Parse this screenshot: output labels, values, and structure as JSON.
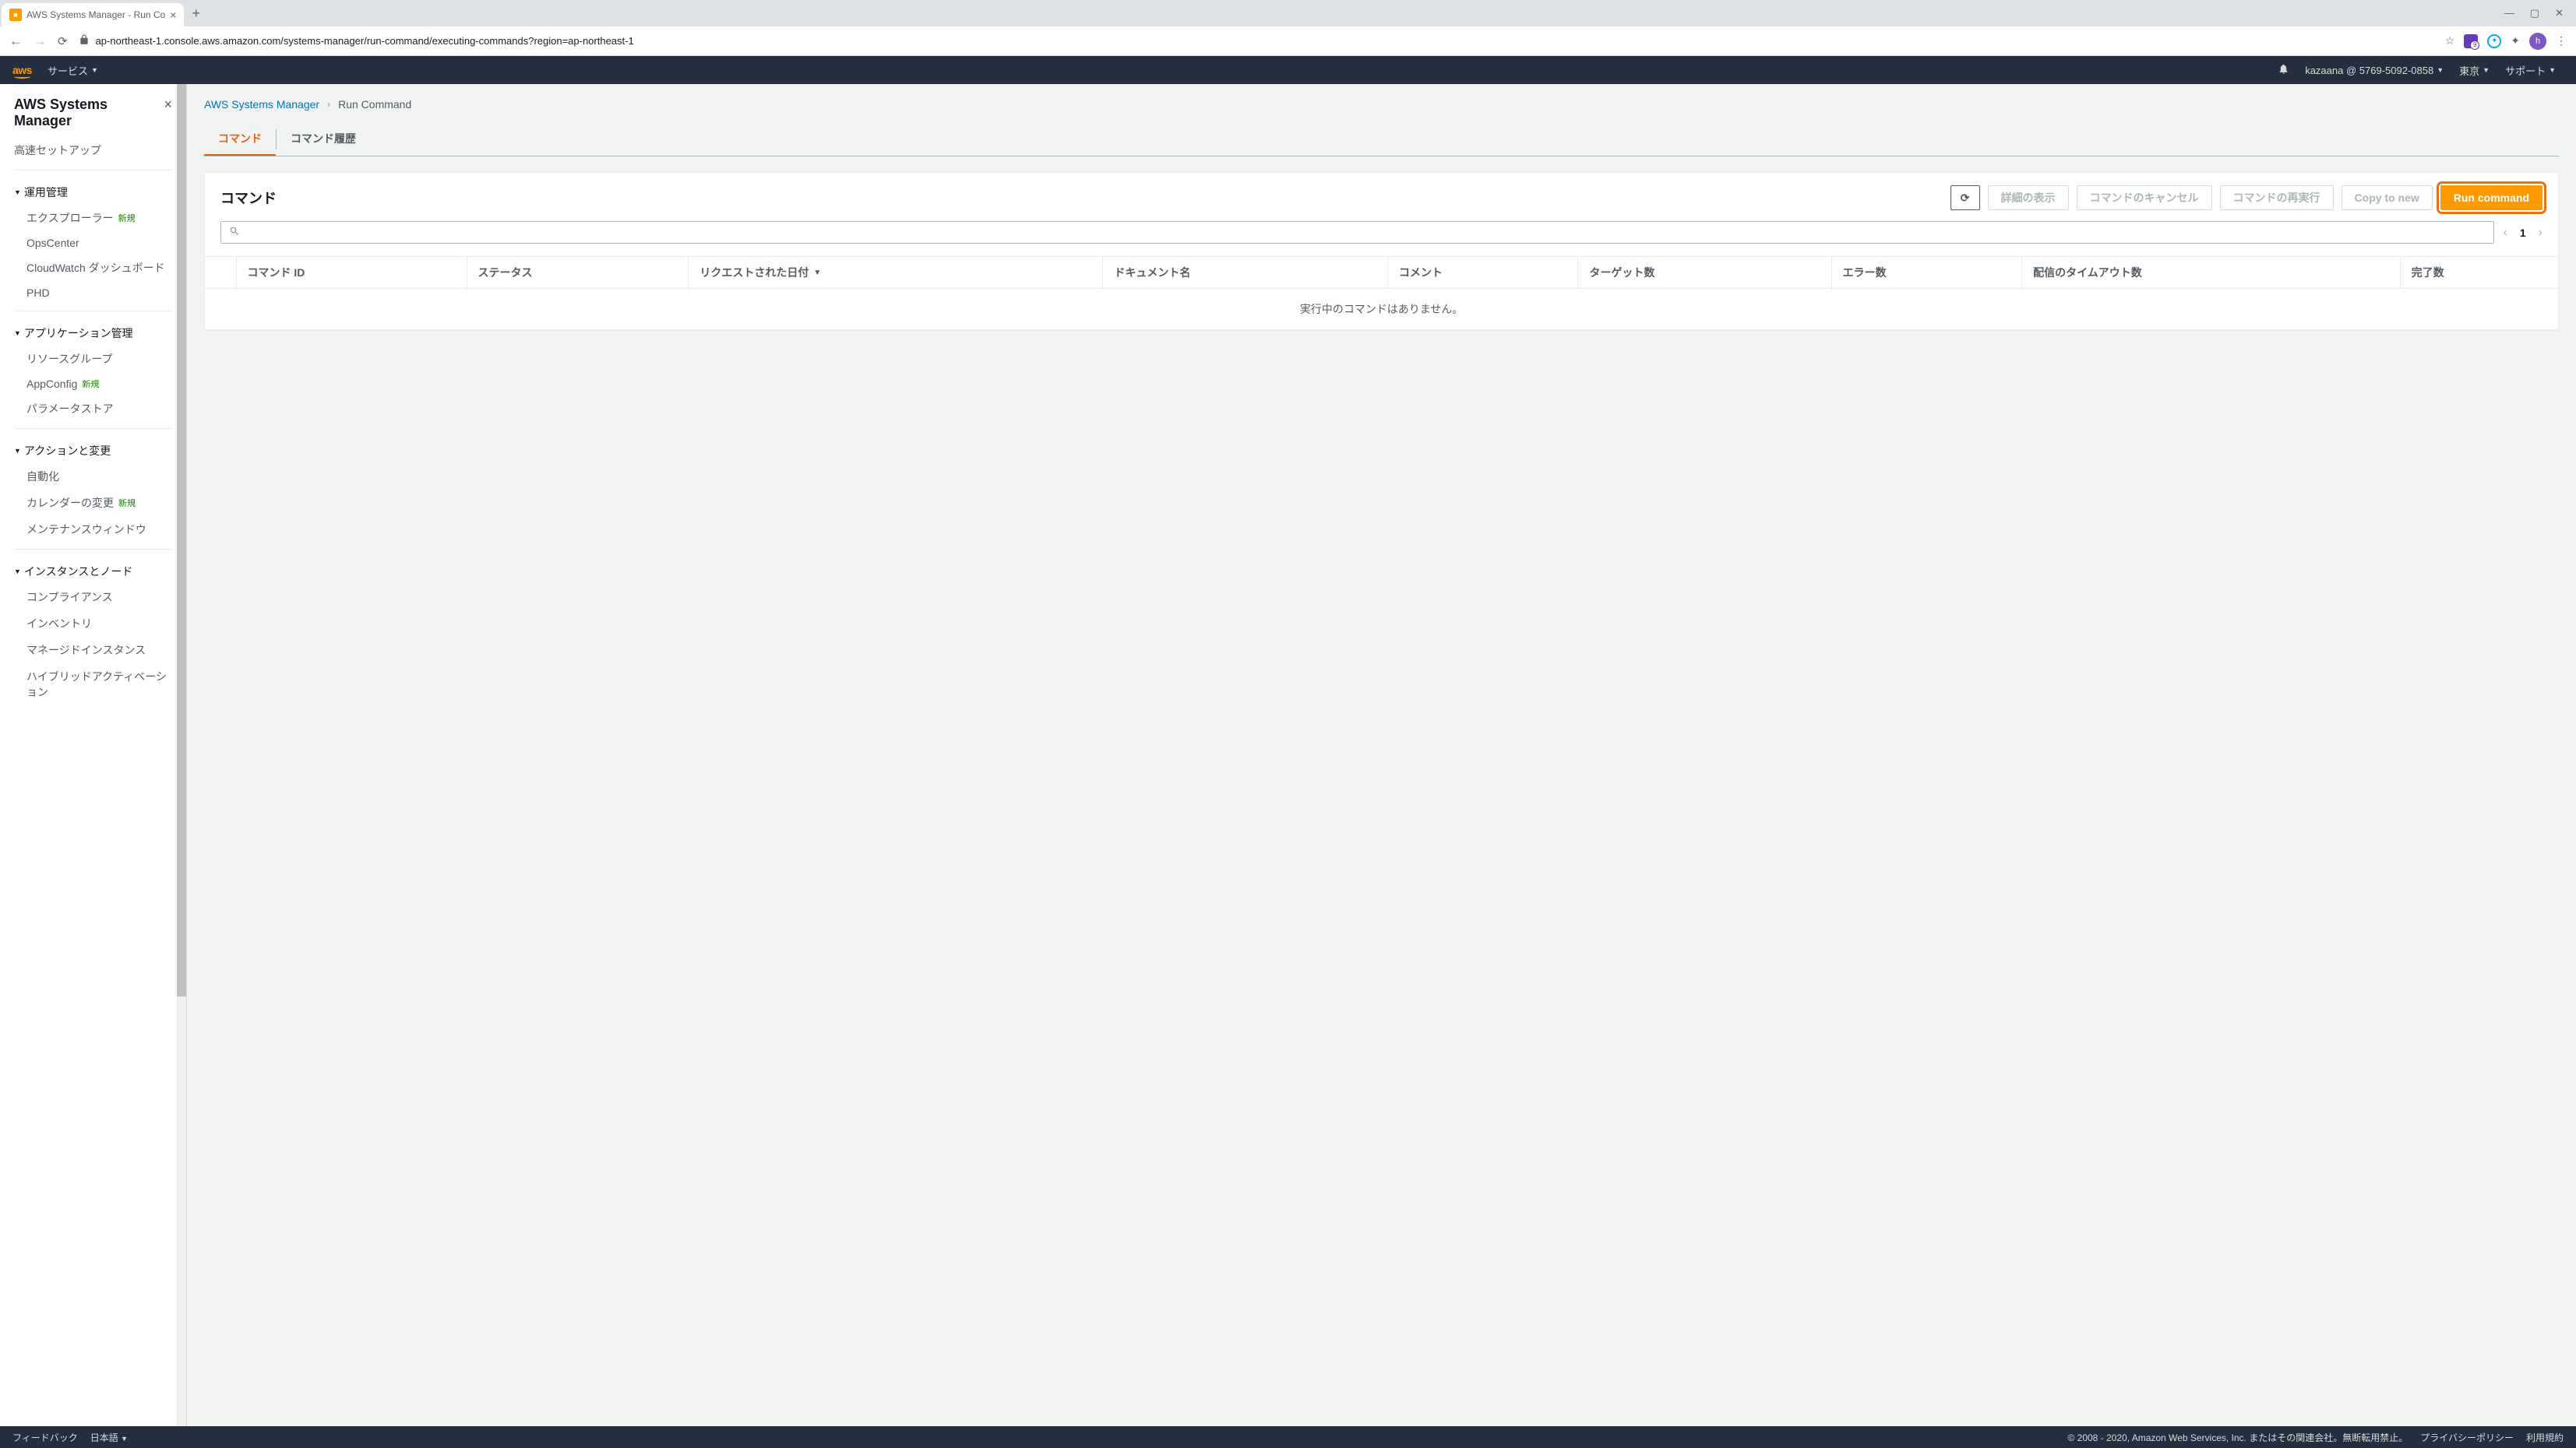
{
  "browser": {
    "tab_title": "AWS Systems Manager - Run Co",
    "url": "ap-northeast-1.console.aws.amazon.com/systems-manager/run-command/executing-commands?region=ap-northeast-1",
    "avatar_letter": "h"
  },
  "header": {
    "logo": "aws",
    "services": "サービス",
    "account": "kazaana @ 5769-5092-0858",
    "region": "東京",
    "support": "サポート"
  },
  "sidebar": {
    "title": "AWS Systems Manager",
    "quick_setup": "高速セットアップ",
    "badge_new": "新規",
    "sections": {
      "ops": {
        "title": "運用管理",
        "items": [
          "エクスプローラー",
          "OpsCenter",
          "CloudWatch ダッシュボード",
          "PHD"
        ],
        "new_flags": [
          true,
          false,
          false,
          false
        ]
      },
      "app": {
        "title": "アプリケーション管理",
        "items": [
          "リソースグループ",
          "AppConfig",
          "パラメータストア"
        ],
        "new_flags": [
          false,
          true,
          false
        ]
      },
      "actions": {
        "title": "アクションと変更",
        "items": [
          "自動化",
          "カレンダーの変更",
          "メンテナンスウィンドウ"
        ],
        "new_flags": [
          false,
          true,
          false
        ]
      },
      "instances": {
        "title": "インスタンスとノード",
        "items": [
          "コンプライアンス",
          "インベントリ",
          "マネージドインスタンス",
          "ハイブリッドアクティベーション"
        ],
        "new_flags": [
          false,
          false,
          false,
          false
        ]
      }
    }
  },
  "breadcrumb": {
    "root": "AWS Systems Manager",
    "current": "Run Command"
  },
  "tabs": {
    "commands": "コマンド",
    "history": "コマンド履歴"
  },
  "panel": {
    "title": "コマンド",
    "btn_details": "詳細の表示",
    "btn_cancel": "コマンドのキャンセル",
    "btn_rerun": "コマンドの再実行",
    "btn_copy": "Copy to new",
    "btn_run": "Run command",
    "page": "1"
  },
  "table": {
    "columns": [
      "コマンド ID",
      "ステータス",
      "リクエストされた日付",
      "ドキュメント名",
      "コメント",
      "ターゲット数",
      "エラー数",
      "配信のタイムアウト数",
      "完了数"
    ],
    "empty": "実行中のコマンドはありません。"
  },
  "footer": {
    "feedback": "フィードバック",
    "language": "日本語",
    "copyright": "© 2008 - 2020, Amazon Web Services, Inc. またはその関連会社。無断転用禁止。",
    "privacy": "プライバシーポリシー",
    "terms": "利用規約"
  }
}
